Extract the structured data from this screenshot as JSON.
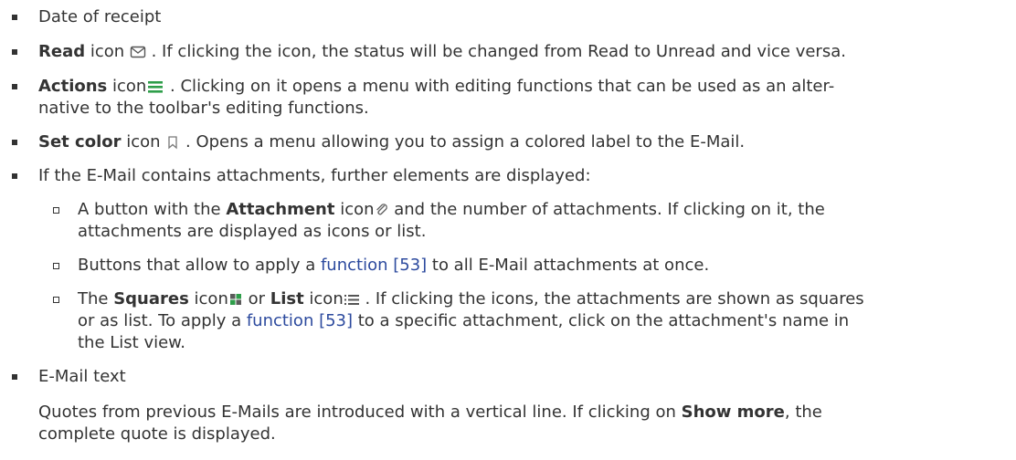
{
  "items": [
    {
      "text": "Date of receipt"
    },
    {
      "bold": "Read",
      "mid": " icon",
      "rest": " . If clicking the icon, the status will be changed from Read to Unread and vice versa.",
      "icon": "envelope-icon"
    },
    {
      "bold": "Actions",
      "mid": " icon",
      "rest": " . Clicking on it opens a menu with editing functions that can be used as an alter-",
      "rest2": "native to the toolbar's editing functions.",
      "icon": "hamburger-icon",
      "icon_color": "#2e9e4a"
    },
    {
      "bold": "Set color",
      "mid": " icon",
      "rest": " . Opens a menu allowing you to assign a colored label to the E-Mail.",
      "icon": "bookmark-icon"
    },
    {
      "text": "If the E-Mail contains attachments, further elements are displayed:"
    }
  ],
  "subitems": [
    {
      "pre": "A button with the ",
      "bold": "Attachment",
      "mid": " icon",
      "rest": " and the number of attachments. If clicking on it, the",
      "rest2": "attachments are displayed as icons or list.",
      "icon": "paperclip-icon"
    },
    {
      "pre": "Buttons that allow to apply a ",
      "link": "function [53]",
      "rest": " to all E-Mail attachments at once."
    },
    {
      "pre": "The ",
      "bold": "Squares",
      "mid": " icon",
      "or": " or ",
      "bold2": "List",
      "mid2": " icon",
      "rest": " . If clicking the icons, the attachments are shown as squares",
      "line2_pre": "or as list. To apply a ",
      "line2_link": "function [53]",
      "line2_rest": " to a specific attachment, click on the attachment's name in",
      "line3": "the List view.",
      "icon1": "grid-icon",
      "icon2": "list-icon"
    }
  ],
  "last": {
    "text": "E-Mail text",
    "para1_pre": "Quotes from previous E-Mails are introduced with a vertical line. If clicking on ",
    "para1_bold": "Show more",
    "para1_rest": ", the",
    "para2": "complete quote is displayed."
  }
}
